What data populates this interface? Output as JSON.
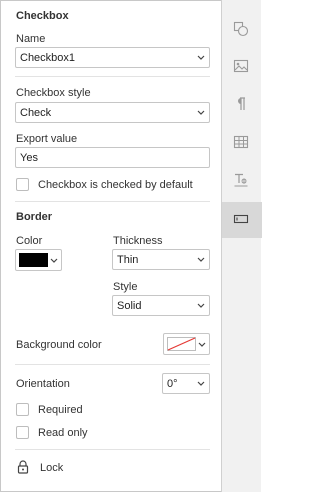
{
  "section_title": "Checkbox",
  "name": {
    "label": "Name",
    "value": "Checkbox1"
  },
  "checkbox_style": {
    "label": "Checkbox style",
    "value": "Check"
  },
  "export_value": {
    "label": "Export value",
    "value": "Yes"
  },
  "checked_default": {
    "label": "Checkbox is checked by default",
    "checked": false
  },
  "border": {
    "title": "Border",
    "color_label": "Color",
    "color_value": "#000000",
    "thickness_label": "Thickness",
    "thickness_value": "Thin",
    "style_label": "Style",
    "style_value": "Solid"
  },
  "background": {
    "label": "Background color"
  },
  "orientation": {
    "label": "Orientation",
    "value": "0°"
  },
  "required": {
    "label": "Required",
    "checked": false
  },
  "read_only": {
    "label": "Read only",
    "checked": false
  },
  "lock": {
    "label": "Lock"
  },
  "sidebar": {
    "items": [
      "shapes-icon",
      "image-icon",
      "paragraph-icon",
      "table-icon",
      "text-art-icon",
      "form-field-icon"
    ],
    "active": "form-field-icon"
  }
}
